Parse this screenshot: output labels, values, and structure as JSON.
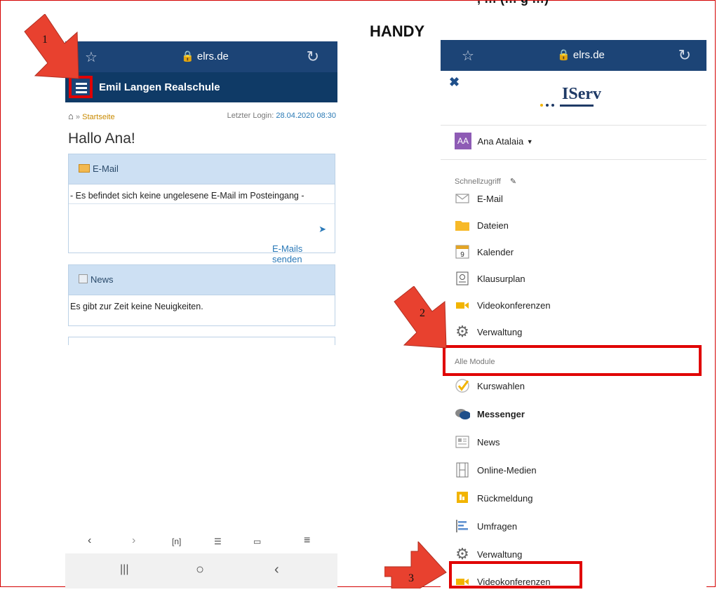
{
  "caption_top": ", … (… g …)",
  "caption_handy": "HANDY",
  "left": {
    "url": "elrs.de",
    "school": "Emil Langen Realschule",
    "breadcrumb_sep": "»",
    "breadcrumb_start": "Startseite",
    "login_label": "Letzter Login:",
    "login_date": "28.04.2020 08:30",
    "greeting": "Hallo Ana!",
    "email_title": "E-Mail",
    "email_empty": "- Es befindet sich keine ungelesene E-Mail im Posteingang -",
    "email_action": "E-Mails senden und empfangen",
    "news_title": "News",
    "news_empty": "Es gibt zur Zeit keine Neuigkeiten."
  },
  "right": {
    "url": "elrs.de",
    "logo": "IServ",
    "user_initials": "AA",
    "user_name": "Ana Atalaia",
    "quick_label": "Schnellzugriff",
    "quick": [
      "E-Mail",
      "Dateien",
      "Kalender",
      "Klausurplan",
      "Videokonferenzen",
      "Verwaltung"
    ],
    "calendar_day": "9",
    "all_label": "Alle Module",
    "modules": [
      "Kurswahlen",
      "Messenger",
      "News",
      "Online-Medien",
      "Rückmeldung",
      "Umfragen",
      "Verwaltung",
      "Videokonferenzen"
    ]
  },
  "markers": [
    "1",
    "2",
    "3"
  ],
  "colors": {
    "navy": "#1c4476",
    "highlight_red": "#e00000",
    "arrow_red": "#e8412f"
  }
}
